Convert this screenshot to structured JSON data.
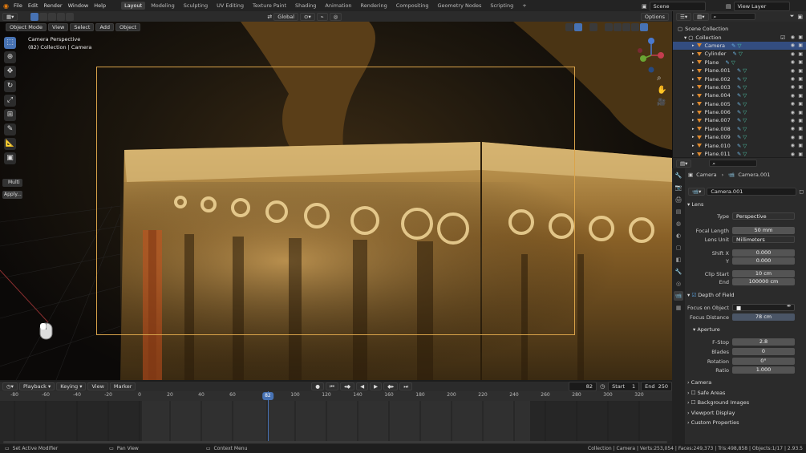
{
  "menu": [
    "File",
    "Edit",
    "Render",
    "Window",
    "Help"
  ],
  "workspaces": [
    "Layout",
    "Modeling",
    "Sculpting",
    "UV Editing",
    "Texture Paint",
    "Shading",
    "Animation",
    "Rendering",
    "Compositing",
    "Geometry Nodes",
    "Scripting"
  ],
  "active_workspace": "Layout",
  "scene": "Scene",
  "view_layer": "View Layer",
  "viewport_header": {
    "mode": "Object Mode",
    "menus": [
      "View",
      "Select",
      "Add",
      "Object"
    ],
    "orientation": "Global",
    "options": "Options"
  },
  "viewport": {
    "title": "Camera Perspective",
    "subtitle": "(82) Collection | Camera",
    "operator_panel": "Multi",
    "operator_apply": "Apply..."
  },
  "outliner": {
    "root": "Scene Collection",
    "collection": "Collection",
    "items": [
      "Camera",
      "Cylinder",
      "Plane",
      "Plane.001",
      "Plane.002",
      "Plane.003",
      "Plane.004",
      "Plane.005",
      "Plane.006",
      "Plane.007",
      "Plane.008",
      "Plane.009",
      "Plane.010",
      "Plane.011"
    ]
  },
  "properties": {
    "breadcrumb_object": "Camera",
    "breadcrumb_data": "Camera.001",
    "datablock": "Camera.001",
    "lens_section": "Lens",
    "type_label": "Type",
    "type_value": "Perspective",
    "focal_label": "Focal Length",
    "focal_value": "50 mm",
    "lens_unit_label": "Lens Unit",
    "lens_unit_value": "Millimeters",
    "shift_x_label": "Shift X",
    "shift_x_value": "0.000",
    "shift_y_label": "Y",
    "shift_y_value": "0.000",
    "clip_start_label": "Clip Start",
    "clip_start_value": "10 cm",
    "clip_end_label": "End",
    "clip_end_value": "100000 cm",
    "dof_section": "Depth of Field",
    "focus_object_label": "Focus on Object",
    "focus_distance_label": "Focus Distance",
    "focus_distance_value": "78 cm",
    "aperture_section": "Aperture",
    "fstop_label": "F-Stop",
    "fstop_value": "2.8",
    "blades_label": "Blades",
    "blades_value": "0",
    "rotation_label": "Rotation",
    "rotation_value": "0°",
    "ratio_label": "Ratio",
    "ratio_value": "1.000",
    "collapsed": [
      "Camera",
      "Safe Areas",
      "Background Images",
      "Viewport Display",
      "Custom Properties"
    ]
  },
  "timeline": {
    "menus": [
      "Playback",
      "Keying",
      "View",
      "Marker"
    ],
    "current_frame": "82",
    "start_label": "Start",
    "start_value": "1",
    "end_label": "End",
    "end_value": "250",
    "ticks": [
      "-80",
      "-60",
      "-40",
      "-20",
      "0",
      "20",
      "40",
      "60",
      "82",
      "100",
      "120",
      "140",
      "160",
      "180",
      "200",
      "220",
      "240",
      "260",
      "280",
      "300",
      "320"
    ],
    "playhead": 82
  },
  "status": {
    "left": "Set Active Modifier",
    "middle": "Pan View",
    "right_hint": "Context Menu",
    "stats": "Collection | Camera | Verts:253,054 | Faces:249,373 | Tris:498,858 | Objects:1/17 | 2.93.5"
  },
  "colors": {
    "accent": "#4772b3",
    "camera_frame": "#d9a34a",
    "object_icon": "#e08a2e",
    "selection": "#334d80"
  }
}
